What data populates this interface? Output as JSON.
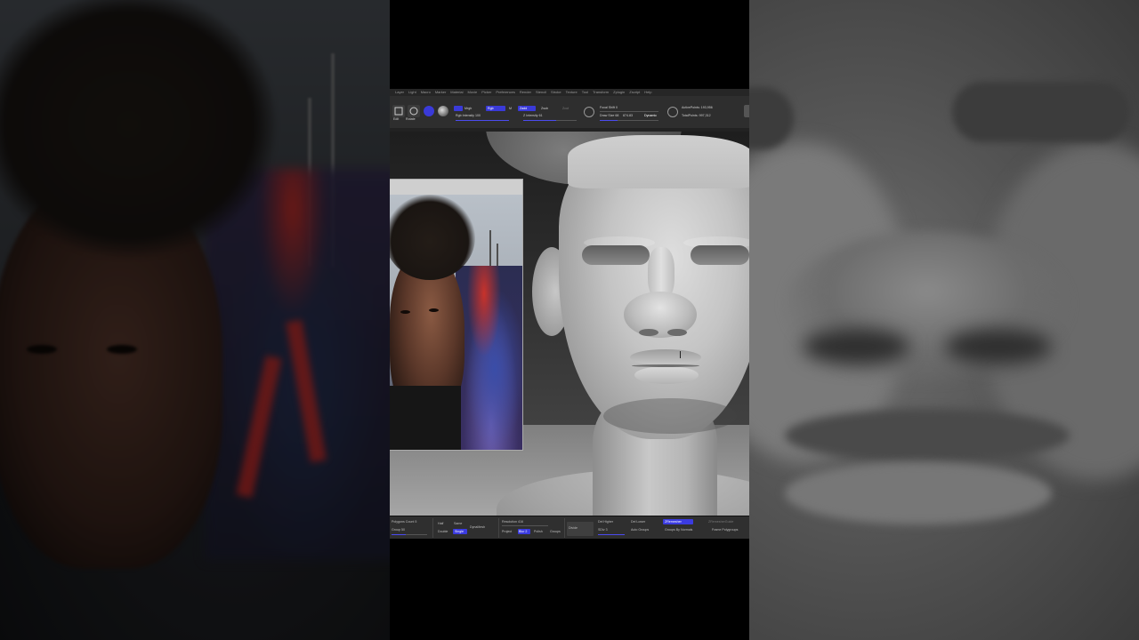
{
  "menu": {
    "items": [
      "Layer",
      "Light",
      "Macro",
      "Marker",
      "Material",
      "Movie",
      "Picker",
      "Preferences",
      "Render",
      "Stencil",
      "Stroke",
      "Texture",
      "Tool",
      "Transform",
      "Zplugin",
      "Zscript",
      "Help"
    ]
  },
  "toolbar": {
    "edit_label": "Edit",
    "rotate_label": "Rotate",
    "mrgb_label": "Mrgb",
    "rgb_label": "Rgb",
    "m_label": "M",
    "zadd_label": "Zadd",
    "zsub_label": "Zsub",
    "zcut_label": "Zcut",
    "rgb_intensity": "Rgb Intensity 100",
    "z_intensity": "Z Intensity 61",
    "focal_shift": "Focal Shift 0",
    "draw_size": "Draw Size 68",
    "draw_size_extra": "874.83",
    "dynamic_label": "Dynamic",
    "active_points": "ActivePoints: 193,956",
    "total_points": "TotalPoints: 997,312"
  },
  "shelf": {
    "polygroups": "Polygons Count 5",
    "smooth": "Group 50",
    "half": "Half",
    "double": "Double",
    "same": "Same",
    "single": "Single",
    "dynamesh": "DynaMesh",
    "resolution": "Resolution 416",
    "project": "Project",
    "blur": "Blur 2",
    "polish": "Polish",
    "groups": "Groups",
    "divide": "Divide",
    "del_higher": "Del Higher",
    "sdiv": "SDiv 3",
    "del_lower": "Del Lower",
    "auto_groups": "Auto Groups",
    "zremesher": "ZRemesher",
    "groups_by_normals": "Groups By Normals",
    "frame_polygons": "Frame Polygroups",
    "zremesher_guide": "ZRemesherGuide"
  },
  "colors": {
    "accent": "#3b3be0",
    "ui_dark": "#2e2e2e",
    "clay": "#c4c4c4"
  },
  "icons": [
    "edit-icon",
    "rotate-icon",
    "material-sphere-icon",
    "texture-sphere-icon",
    "focal-shift-dial-icon",
    "draw-size-dial-icon"
  ]
}
